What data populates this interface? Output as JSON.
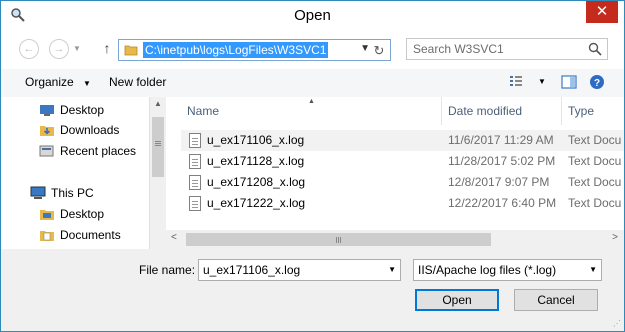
{
  "window": {
    "title": "Open",
    "close_glyph": "✕"
  },
  "address": {
    "path": "C:\\inetpub\\logs\\LogFiles\\W3SVC1"
  },
  "search": {
    "placeholder": "Search W3SVC1"
  },
  "toolbar": {
    "organize_label": "Organize",
    "new_folder_label": "New folder"
  },
  "sidebar": {
    "items": [
      {
        "label": "Desktop",
        "icon": "desktop-icon"
      },
      {
        "label": "Downloads",
        "icon": "downloads-icon"
      },
      {
        "label": "Recent places",
        "icon": "recent-places-icon"
      },
      {
        "label": "This PC",
        "icon": "this-pc-icon"
      },
      {
        "label": "Desktop",
        "icon": "desktop-icon"
      },
      {
        "label": "Documents",
        "icon": "documents-icon"
      }
    ]
  },
  "columns": {
    "name": "Name",
    "date": "Date modified",
    "type": "Type"
  },
  "files": [
    {
      "name": "u_ex171106_x.log",
      "date": "11/6/2017 11:29 AM",
      "type": "Text Docu"
    },
    {
      "name": "u_ex171128_x.log",
      "date": "11/28/2017 5:02 PM",
      "type": "Text Docu"
    },
    {
      "name": "u_ex171208_x.log",
      "date": "12/8/2017 9:07 PM",
      "type": "Text Docu"
    },
    {
      "name": "u_ex171222_x.log",
      "date": "12/22/2017 6:40 PM",
      "type": "Text Docu"
    }
  ],
  "filename": {
    "label": "File name:",
    "value": "u_ex171106_x.log"
  },
  "filetype": {
    "value": "IIS/Apache log files (*.log)"
  },
  "buttons": {
    "open": "Open",
    "cancel": "Cancel"
  },
  "colors": {
    "accent": "#0078d7",
    "selection": "#3399ff",
    "close": "#c42b1c"
  }
}
